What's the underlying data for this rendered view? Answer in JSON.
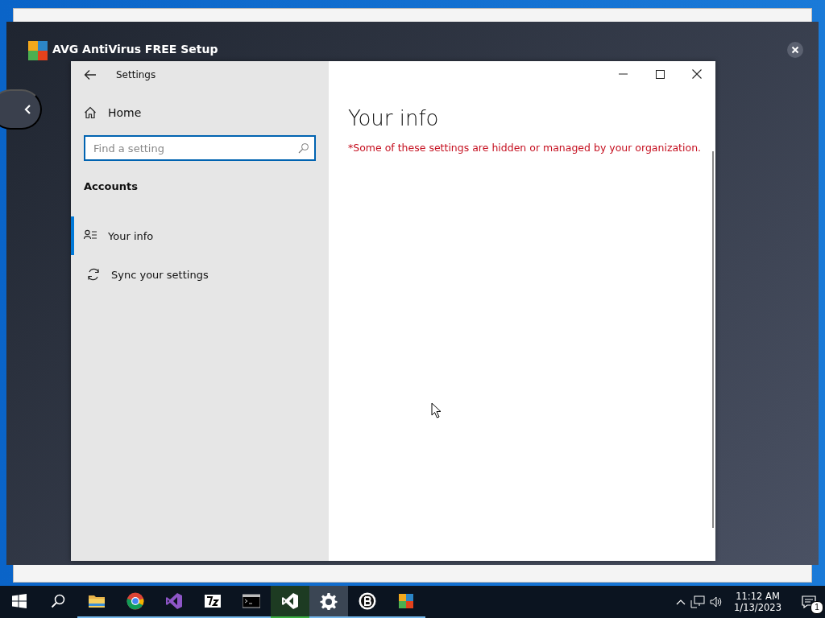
{
  "background_window": {
    "title": "AVG AntiVirus FREE Setup"
  },
  "settings_window": {
    "title": "Settings",
    "home": {
      "label": "Home"
    },
    "search": {
      "placeholder": "Find a setting"
    },
    "section": "Accounts",
    "nav_items": [
      {
        "kind": "person",
        "label": "Your info",
        "selected": true
      },
      {
        "kind": "sync",
        "label": "Sync your settings",
        "selected": false
      }
    ],
    "page_title": "Your info",
    "notice": "*Some of these settings are hidden or managed by your organization."
  },
  "taskbar": {
    "apps": [
      {
        "kind": "folder",
        "running": true,
        "active": false
      },
      {
        "kind": "chrome",
        "running": true,
        "active": false
      },
      {
        "kind": "vs",
        "running": true,
        "active": false
      },
      {
        "kind": "archive",
        "running": true,
        "active": false
      },
      {
        "kind": "terminal",
        "running": true,
        "active": false
      },
      {
        "kind": "vscode",
        "running": true,
        "active": false
      },
      {
        "kind": "gear",
        "running": true,
        "active": true
      },
      {
        "kind": "b",
        "running": true,
        "active": false
      },
      {
        "kind": "avg",
        "running": true,
        "active": false
      }
    ],
    "time": "11:12 AM",
    "date": "1/13/2023",
    "notifications": "1"
  }
}
